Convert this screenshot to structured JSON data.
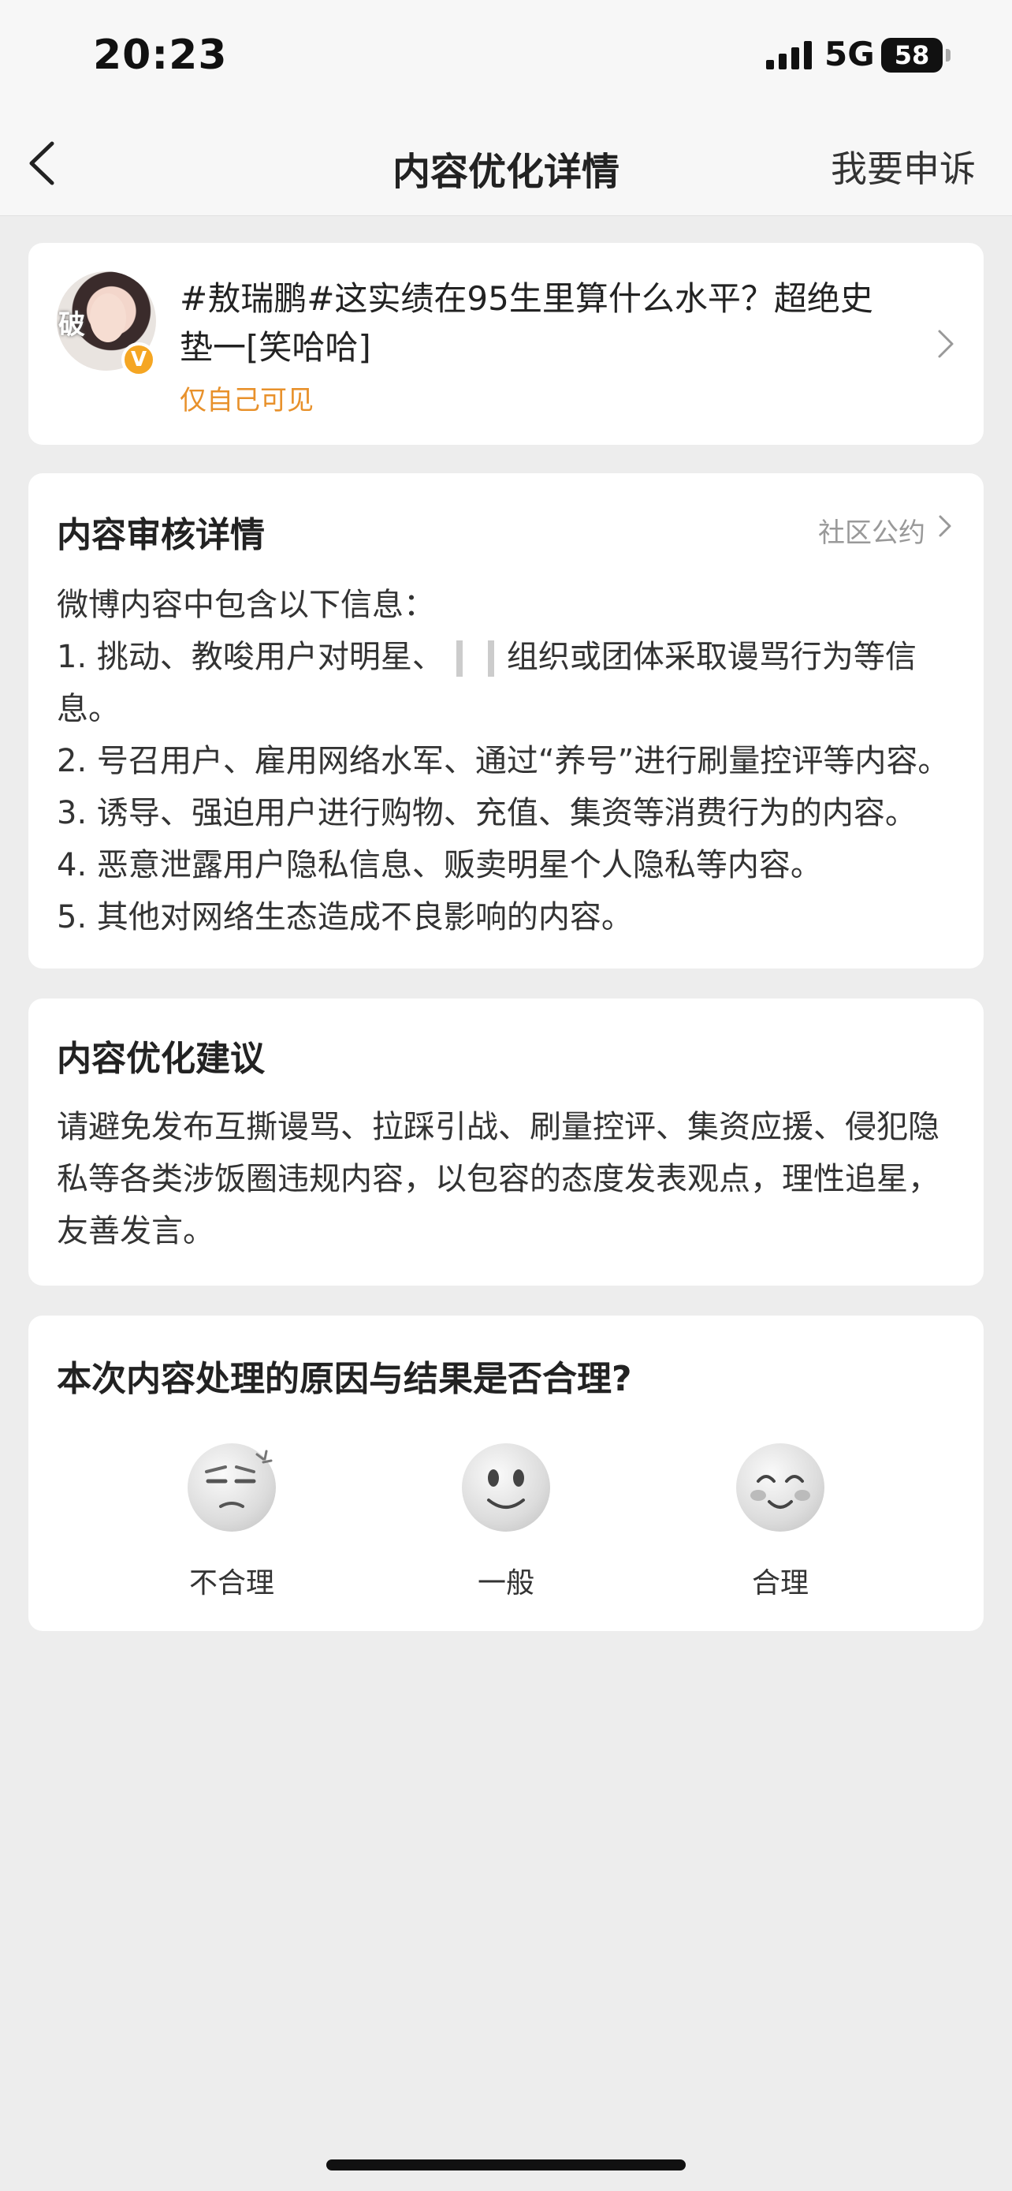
{
  "status_bar": {
    "time": "20:23",
    "network": "5G",
    "battery": "58"
  },
  "nav": {
    "title": "内容优化详情",
    "appeal_label": "我要申诉"
  },
  "post": {
    "avatar_text": "破",
    "verified_badge": "V",
    "text": "#敖瑞鹏#这实绩在95生里算什么水平？超绝史垫一[笑哈哈]",
    "visibility": "仅自己可见"
  },
  "review": {
    "title": "内容审核详情",
    "rules_link": "社区公约",
    "intro": "微博内容中包含以下信息：",
    "item1_a": "1. 挑动、教唆用户对明星、",
    "item1_b": "组织或团体采取谩骂行为等信息。",
    "items": [
      "2. 号召用户、雇用网络水军、通过“养号”进行刷量控评等内容。",
      "3. 诱导、强迫用户进行购物、充值、集资等消费行为的内容。",
      "4. 恶意泄露用户隐私信息、贩卖明星个人隐私等内容。",
      "5. 其他对网络生态造成不良影响的内容。"
    ]
  },
  "suggestion": {
    "title": "内容优化建议",
    "body": "请避免发布互撕谩骂、拉踩引战、刷量控评、集资应援、侵犯隐私等各类涉饭圈违规内容，以包容的态度发表观点，理性追星，友善发言。"
  },
  "feedback": {
    "question": "本次内容处理的原因与结果是否合理?",
    "options": [
      {
        "label": "不合理",
        "icon": "annoyed-face-icon"
      },
      {
        "label": "一般",
        "icon": "neutral-face-icon"
      },
      {
        "label": "合理",
        "icon": "happy-face-icon"
      }
    ]
  },
  "colors": {
    "accent_orange": "#e8912b",
    "page_bg": "#ededed"
  }
}
